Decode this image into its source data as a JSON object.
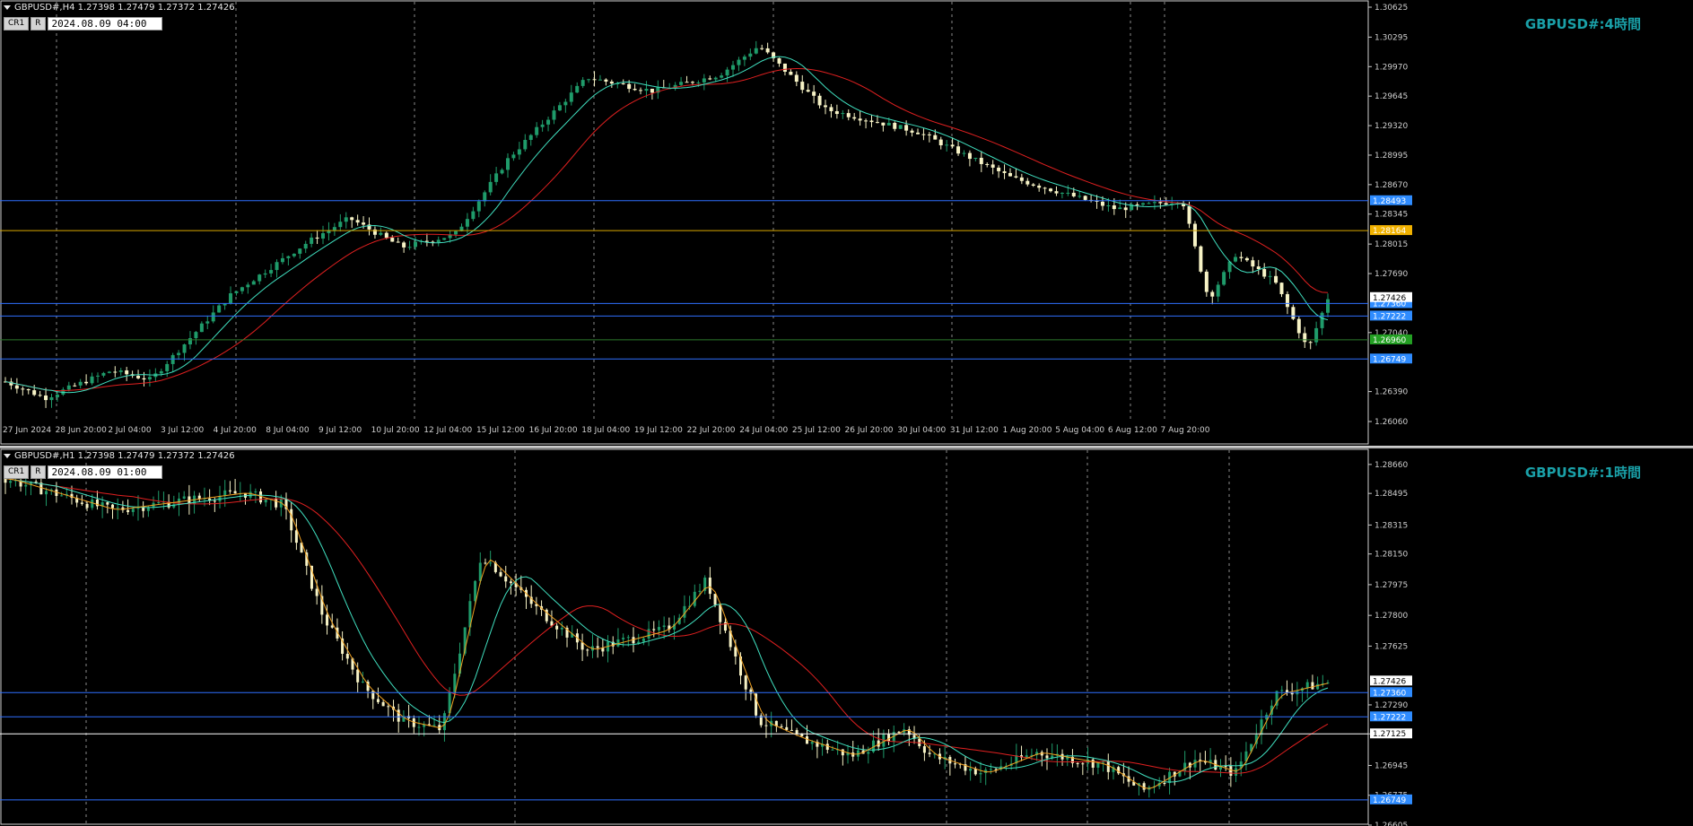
{
  "top": {
    "header": "GBPUSD#,H4  1.27398 1.27479 1.27372 1.27426",
    "tag1": "CR1",
    "tag2": "R",
    "time_box": "2024.08.09 04:00",
    "title": "GBPUSD#:4時間",
    "price_axis": [
      "1.30625",
      "1.30295",
      "1.29970",
      "1.29645",
      "1.29320",
      "1.28995",
      "1.28670",
      "1.28345",
      "1.28015",
      "1.27690",
      "1.27040",
      "1.26390",
      "1.26060"
    ],
    "hlines": [
      {
        "label": "1.28493",
        "price": 1.28493,
        "color": "#2f6fff",
        "tag_bg": "#2f8cff"
      },
      {
        "label": "1.28164",
        "price": 1.28164,
        "color": "#d9a800",
        "tag_bg": "#f1b200"
      },
      {
        "label": "1.27360",
        "price": 1.2736,
        "color": "#2f6fff",
        "tag_bg": "#2f8cff"
      },
      {
        "label": "1.27222",
        "price": 1.27222,
        "color": "#2f6fff",
        "tag_bg": "#2f8cff"
      },
      {
        "label": "1.26960",
        "price": 1.2696,
        "color": "#2c7a2c",
        "tag_bg": "#23a023"
      },
      {
        "label": "1.26749",
        "price": 1.26749,
        "color": "#2f6fff",
        "tag_bg": "#2f8cff"
      }
    ],
    "current_price": "1.27426",
    "time_axis": [
      "27 Jun 2024",
      "28 Jun 20:00",
      "2 Jul 04:00",
      "3 Jul 12:00",
      "4 Jul 20:00",
      "8 Jul 04:00",
      "9 Jul 12:00",
      "10 Jul 20:00",
      "12 Jul 04:00",
      "15 Jul 12:00",
      "16 Jul 20:00",
      "18 Jul 04:00",
      "19 Jul 12:00",
      "22 Jul 20:00",
      "24 Jul 04:00",
      "25 Jul 12:00",
      "26 Jul 20:00",
      "30 Jul 04:00",
      "31 Jul 12:00",
      "1 Aug 20:00",
      "5 Aug 04:00",
      "6 Aug 12:00",
      "7 Aug 20:00"
    ]
  },
  "bottom": {
    "header": "GBPUSD#,H1  1.27398 1.27479 1.27372 1.27426",
    "tag1": "CR1",
    "tag2": "R",
    "time_box": "2024.08.09 01:00",
    "title": "GBPUSD#:1時間",
    "price_axis": [
      "1.28660",
      "1.28495",
      "1.28315",
      "1.28150",
      "1.27975",
      "1.27800",
      "1.27625",
      "1.27290",
      "1.27125",
      "1.26945",
      "1.26775",
      "1.26605"
    ],
    "hlines": [
      {
        "label": "1.27360",
        "price": 1.2736,
        "color": "#2f6fff",
        "tag_bg": "#2f8cff"
      },
      {
        "label": "1.27222",
        "price": 1.27222,
        "color": "#2f6fff",
        "tag_bg": "#2f8cff"
      },
      {
        "label": "1.27125",
        "price": 1.27125,
        "color": "#ffffff",
        "tag_bg": "#ffffff"
      },
      {
        "label": "1.26749",
        "price": 1.26749,
        "color": "#2f6fff",
        "tag_bg": "#2f8cff"
      }
    ],
    "current_price": "1.27426"
  },
  "colors": {
    "bull": "#1f9b6a",
    "bear": "#f7f3c6",
    "ma_red": "#e02020",
    "ma_cyan": "#40e0c0",
    "zig_orange": "#f0a020",
    "grid": "#8a8a8a"
  }
}
